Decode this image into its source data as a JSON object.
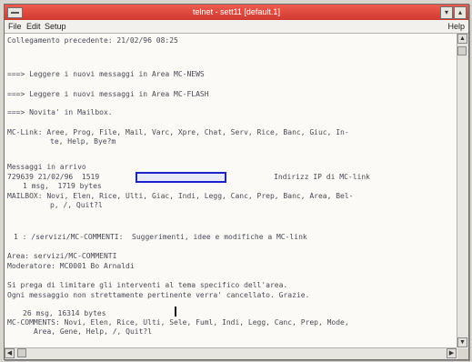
{
  "window": {
    "title": "telnet - sett11 [default.1]"
  },
  "menu": {
    "file": "File",
    "edit": "Edit",
    "setup": "Setup",
    "help": "Help"
  },
  "terminal": {
    "lines": [
      "Collegamento precedente: 21/02/96 08:25",
      "===> Leggere i nuovi messaggi in Area MC-NEWS",
      "===> Leggere i nuovi messaggi in Area MC-FLASH",
      "===> Novita' in Mailbox.",
      "MC-Link: Aree, Prog, File, Mail, Varc, Xpre, Chat, Serv, Rice, Banc, Giuc, In-",
      "te, Help, Bye?m",
      "Messaggi in arrivo",
      "729639 21/02/96  1519",
      "Indirizz IP di MC-link",
      "1 msg,  1719 bytes",
      "MAILBOX: Novi, Elen, Rice, Ulti, Giac, Indi, Legg, Canc, Prep, Banc, Area, Bel-",
      "p, /, Quit?l",
      "1 : /servizi/MC-COMMENTI:  Suggerimenti, idee e modifiche a MC-link",
      "Area: servizi/MC-COMMENTI",
      "Moderatore: MC0001 Bo Arnaldi",
      "Si prega di limitare gli interventi al tema specifico dell'area.",
      "Ogni messaggio non strettamente pertinente verra' cancellato. Grazie.",
      "26 msg, 16314 bytes",
      "MC-COMMENTS: Novi, Elen, Rice, Ulti, Sele, Fuml, Indi, Legg, Canc, Prep, Mode,",
      "Area, Gene, Help, /, Quit?l"
    ]
  }
}
